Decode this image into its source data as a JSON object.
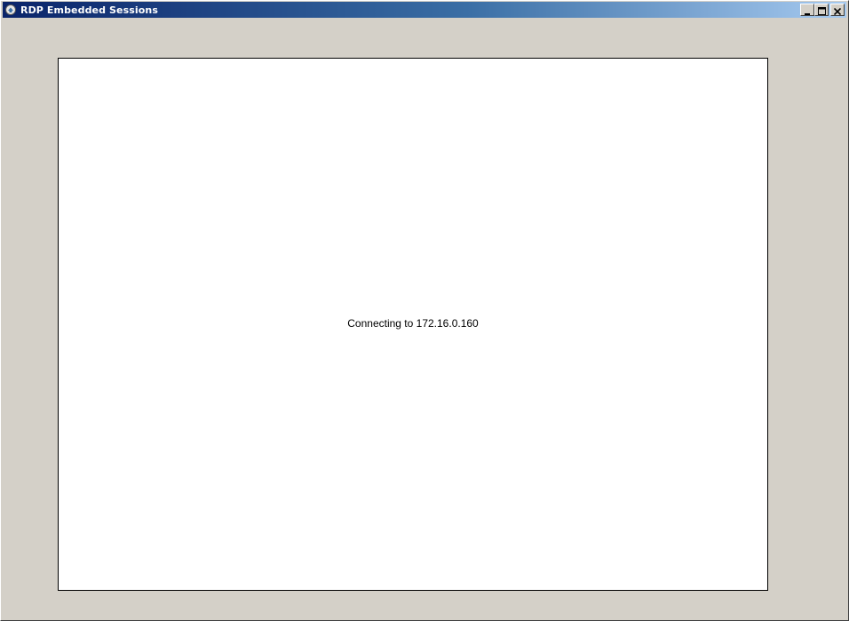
{
  "window": {
    "title": "RDP Embedded Sessions",
    "icon": "rdp-app-icon",
    "caption_buttons": [
      {
        "name": "minimize",
        "icon": "minimize-icon"
      },
      {
        "name": "maximize",
        "icon": "maximize-icon"
      },
      {
        "name": "close",
        "icon": "close-icon"
      }
    ]
  },
  "session": {
    "status_text": "Connecting to 172.16.0.160"
  },
  "colors": {
    "titlebar_start": "#0a246a",
    "titlebar_end": "#a6caf0",
    "face": "#d4d0c8",
    "session_bg": "#ffffff"
  }
}
